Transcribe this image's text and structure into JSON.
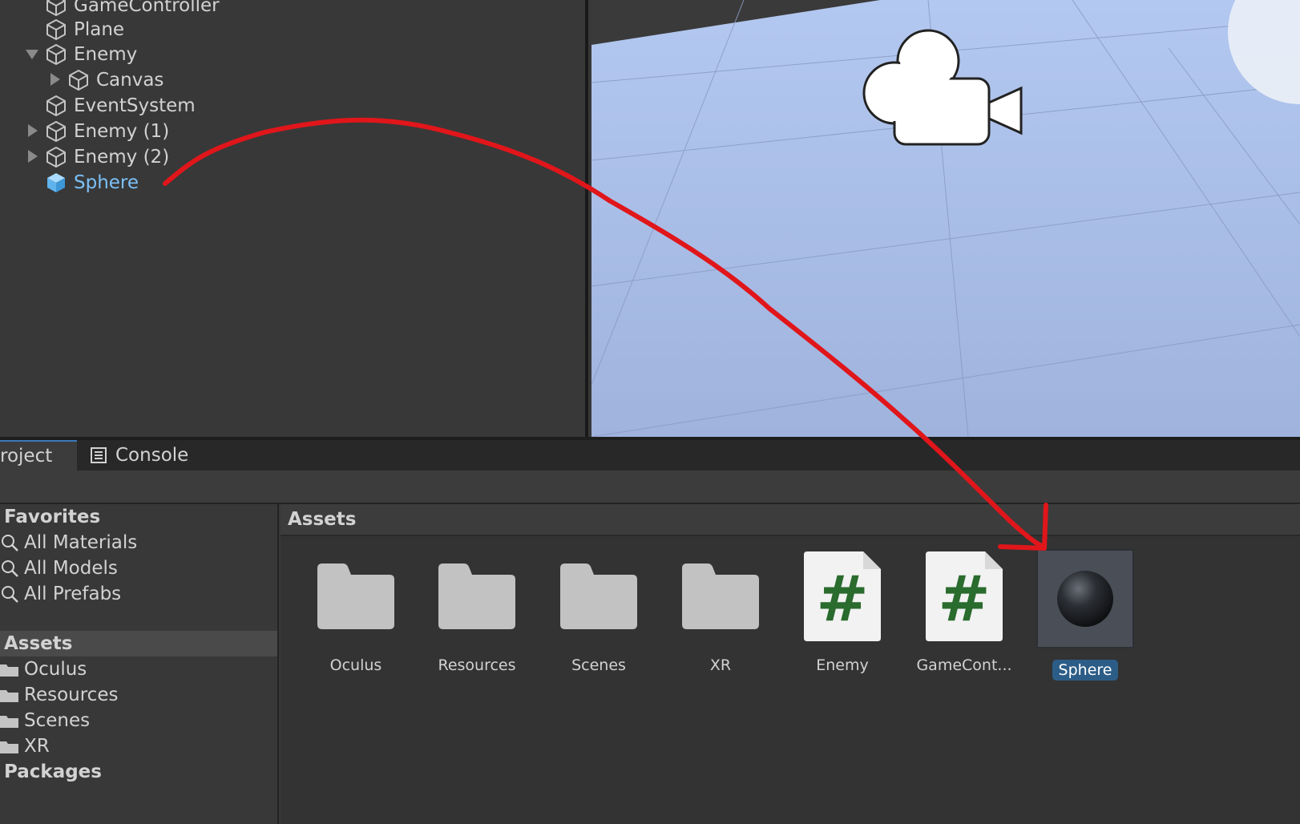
{
  "hierarchy": {
    "items": [
      {
        "label": "GameController"
      },
      {
        "label": "Plane"
      },
      {
        "label": "Enemy"
      },
      {
        "label": "Canvas"
      },
      {
        "label": "EventSystem"
      },
      {
        "label": "Enemy (1)"
      },
      {
        "label": "Enemy (2)"
      },
      {
        "label": "Sphere"
      }
    ]
  },
  "tabs": {
    "project": "roject",
    "console": "Console"
  },
  "project": {
    "favorites_header": "Favorites",
    "favorites": [
      "All Materials",
      "All Models",
      "All Prefabs"
    ],
    "assets_header": "Assets",
    "asset_folders": [
      "Oculus",
      "Resources",
      "Scenes",
      "XR"
    ],
    "packages_header": "Packages",
    "breadcrumb": "Assets",
    "grid": [
      {
        "label": "Oculus",
        "icon": "folder-icon"
      },
      {
        "label": "Resources",
        "icon": "folder-icon"
      },
      {
        "label": "Scenes",
        "icon": "folder-icon"
      },
      {
        "label": "XR",
        "icon": "folder-icon"
      },
      {
        "label": "Enemy",
        "icon": "csharp-script-icon"
      },
      {
        "label": "GameCont...",
        "icon": "csharp-script-icon"
      },
      {
        "label": "Sphere",
        "icon": "sphere-prefab-icon"
      }
    ]
  },
  "colors": {
    "selection_text": "#7cc0f7",
    "selection_bg": "#2c5d87",
    "annotation": "#e0161b",
    "script_hash": "#2a6b2e"
  }
}
